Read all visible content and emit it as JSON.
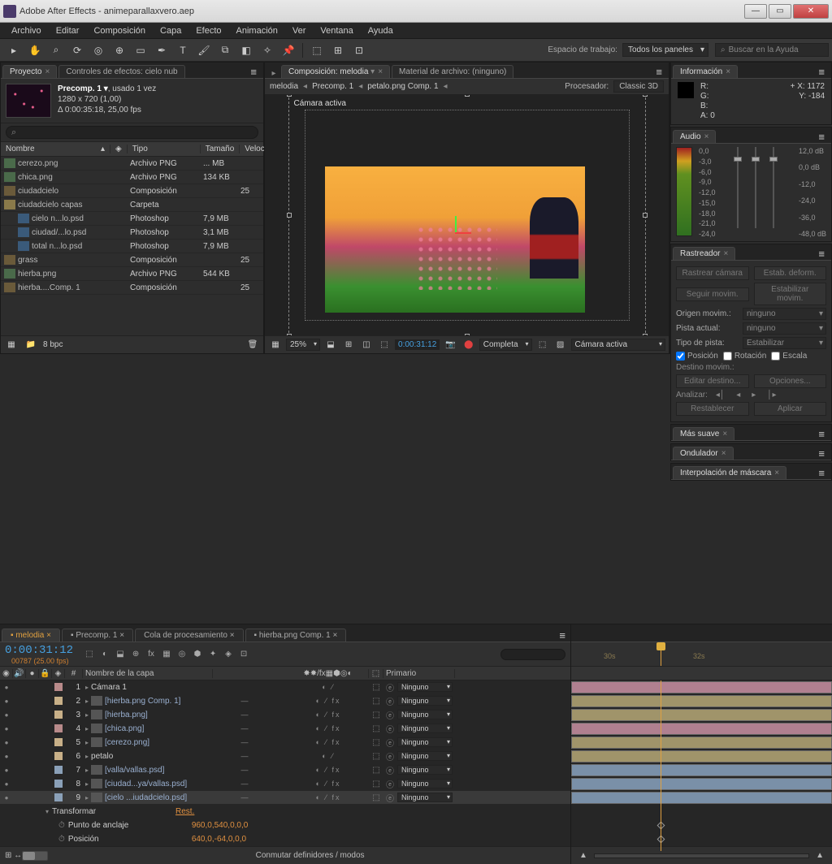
{
  "window": {
    "title": "Adobe After Effects - animeparallaxvero.aep"
  },
  "menu": [
    "Archivo",
    "Editar",
    "Composición",
    "Capa",
    "Efecto",
    "Animación",
    "Ver",
    "Ventana",
    "Ayuda"
  ],
  "toolbar": {
    "workspace_label": "Espacio de trabajo:",
    "workspace_value": "Todos los paneles",
    "search_placeholder": "Buscar en la Ayuda"
  },
  "project": {
    "tab_project": "Proyecto",
    "tab_effects": "Controles de efectos: cielo nub",
    "precomp_name": "Precomp. 1",
    "precomp_used": ", usado 1 vez",
    "precomp_res": "1280 x 720 (1,00)",
    "precomp_dur": "Δ 0:00:35:18, 25,00 fps",
    "cols": {
      "name": "Nombre",
      "tag": "",
      "type": "Tipo",
      "size": "Tamaño",
      "vel": "Velocid"
    },
    "items": [
      {
        "icon": "img",
        "name": "cerezo.png",
        "type": "Archivo PNG",
        "size": "... MB",
        "vel": "",
        "indent": 0
      },
      {
        "icon": "img",
        "name": "chica.png",
        "type": "Archivo PNG",
        "size": "134 KB",
        "vel": "",
        "indent": 0
      },
      {
        "icon": "comp",
        "name": "ciudadcielo",
        "type": "Composición",
        "size": "",
        "vel": "25",
        "indent": 0
      },
      {
        "icon": "folder",
        "name": "ciudadcielo capas",
        "type": "Carpeta",
        "size": "",
        "vel": "",
        "indent": 0
      },
      {
        "icon": "psd",
        "name": "cielo n...lo.psd",
        "type": "Photoshop",
        "size": "7,9 MB",
        "vel": "",
        "indent": 1
      },
      {
        "icon": "psd",
        "name": "ciudad/...lo.psd",
        "type": "Photoshop",
        "size": "3,1 MB",
        "vel": "",
        "indent": 1
      },
      {
        "icon": "psd",
        "name": "total n...lo.psd",
        "type": "Photoshop",
        "size": "7,9 MB",
        "vel": "",
        "indent": 1
      },
      {
        "icon": "comp",
        "name": "grass",
        "type": "Composición",
        "size": "",
        "vel": "25",
        "indent": 0
      },
      {
        "icon": "img",
        "name": "hierba.png",
        "type": "Archivo PNG",
        "size": "544 KB",
        "vel": "",
        "indent": 0
      },
      {
        "icon": "comp",
        "name": "hierba....Comp. 1",
        "type": "Composición",
        "size": "",
        "vel": "25",
        "indent": 0
      }
    ],
    "footer_bpc": "8 bpc"
  },
  "comp": {
    "tab_comp": "Composición: melodia",
    "tab_footage": "Material de archivo: (ninguno)",
    "bread": [
      "melodia",
      "Precomp. 1",
      "petalo.png Comp. 1"
    ],
    "renderer_label": "Procesador:",
    "renderer_value": "Classic 3D",
    "camera_label": "Cámara activa",
    "footer": {
      "zoom": "25%",
      "timecode": "0:00:31:12",
      "quality": "Completa",
      "camera": "Cámara activa"
    }
  },
  "info": {
    "title": "Información",
    "r": "R:",
    "g": "G:",
    "b": "B:",
    "a": "A:",
    "a_val": "0",
    "x_label": "X:",
    "x": "1172",
    "y_label": "Y:",
    "y": "-184"
  },
  "audio": {
    "title": "Audio",
    "left_scale": [
      "0,0",
      "-3,0",
      "-6,0",
      "-9,0",
      "-12,0",
      "-15,0",
      "-18,0",
      "-21,0",
      "-24,0"
    ],
    "right_scale": [
      "12,0 dB",
      "0,0 dB",
      "-12,0",
      "-24,0",
      "-36,0",
      "-48,0 dB"
    ]
  },
  "tracker": {
    "title": "Rastreador",
    "btn_trackcam": "Rastrear cámara",
    "btn_warp": "Estab. deform.",
    "btn_follow": "Seguir movim.",
    "btn_stab": "Estabilizar movim.",
    "origin_label": "Origen movim.:",
    "origin_val": "ninguno",
    "track_label": "Pista actual:",
    "track_val": "ninguno",
    "type_label": "Tipo de pista:",
    "type_val": "Estabilizar",
    "chk_pos": "Posición",
    "chk_rot": "Rotación",
    "chk_scale": "Escala",
    "dest_label": "Destino movim.:",
    "btn_edit": "Editar destino...",
    "btn_opts": "Opciones...",
    "analyze_label": "Analizar:",
    "btn_reset": "Restablecer",
    "btn_apply": "Aplicar"
  },
  "small_panels": {
    "smoother": "Más suave",
    "wiggler": "Ondulador",
    "mask_interp": "Interpolación de máscara"
  },
  "timeline": {
    "tabs": [
      "melodia",
      "Precomp. 1",
      "Cola de procesamiento",
      "hierba.png Comp. 1"
    ],
    "timecode": "0:00:31:12",
    "frame_info": "00787 (25.00 fps)",
    "cols": {
      "num": "#",
      "name": "Nombre de la capa",
      "mode": "",
      "sw": "",
      "par": "Primario"
    },
    "parent_none": "Ninguno",
    "layers": [
      {
        "num": 1,
        "name": "Cámara 1",
        "cam": true,
        "color": "#b88a8a",
        "mode": "",
        "fx": false
      },
      {
        "num": 2,
        "name": "[hierba.png Comp. 1]",
        "color": "#c8b088",
        "mode": "—",
        "fx": true
      },
      {
        "num": 3,
        "name": "[hierba.png]",
        "color": "#c8b088",
        "mode": "—",
        "fx": true
      },
      {
        "num": 4,
        "name": "[chica.png]",
        "color": "#b88a8a",
        "mode": "—",
        "fx": true
      },
      {
        "num": 5,
        "name": "[cerezo.png]",
        "color": "#c8b088",
        "mode": "—",
        "fx": true
      },
      {
        "num": 6,
        "name": "petalo",
        "cam": true,
        "color": "#c8b088",
        "mode": "—",
        "fx": false
      },
      {
        "num": 7,
        "name": "[valla/vallas.psd]",
        "color": "#8aa0b8",
        "mode": "—",
        "fx": true
      },
      {
        "num": 8,
        "name": "[ciudad...ya/vallas.psd]",
        "color": "#8aa0b8",
        "mode": "—",
        "fx": true
      },
      {
        "num": 9,
        "name": "[cielo ...iudadcielo.psd]",
        "sel": true,
        "color": "#8aa0b8",
        "mode": "—",
        "fx": true
      }
    ],
    "transform": "Transformar",
    "reset": "Rest.",
    "anchor": "Punto de anclaje",
    "anchor_val": "960,0,540,0,0,0",
    "position": "Posición",
    "position_val": "640,0,-64,0,0,0",
    "footer_label": "Conmutar definidores / modos",
    "ruler_marks": [
      "30s",
      "32s"
    ]
  }
}
